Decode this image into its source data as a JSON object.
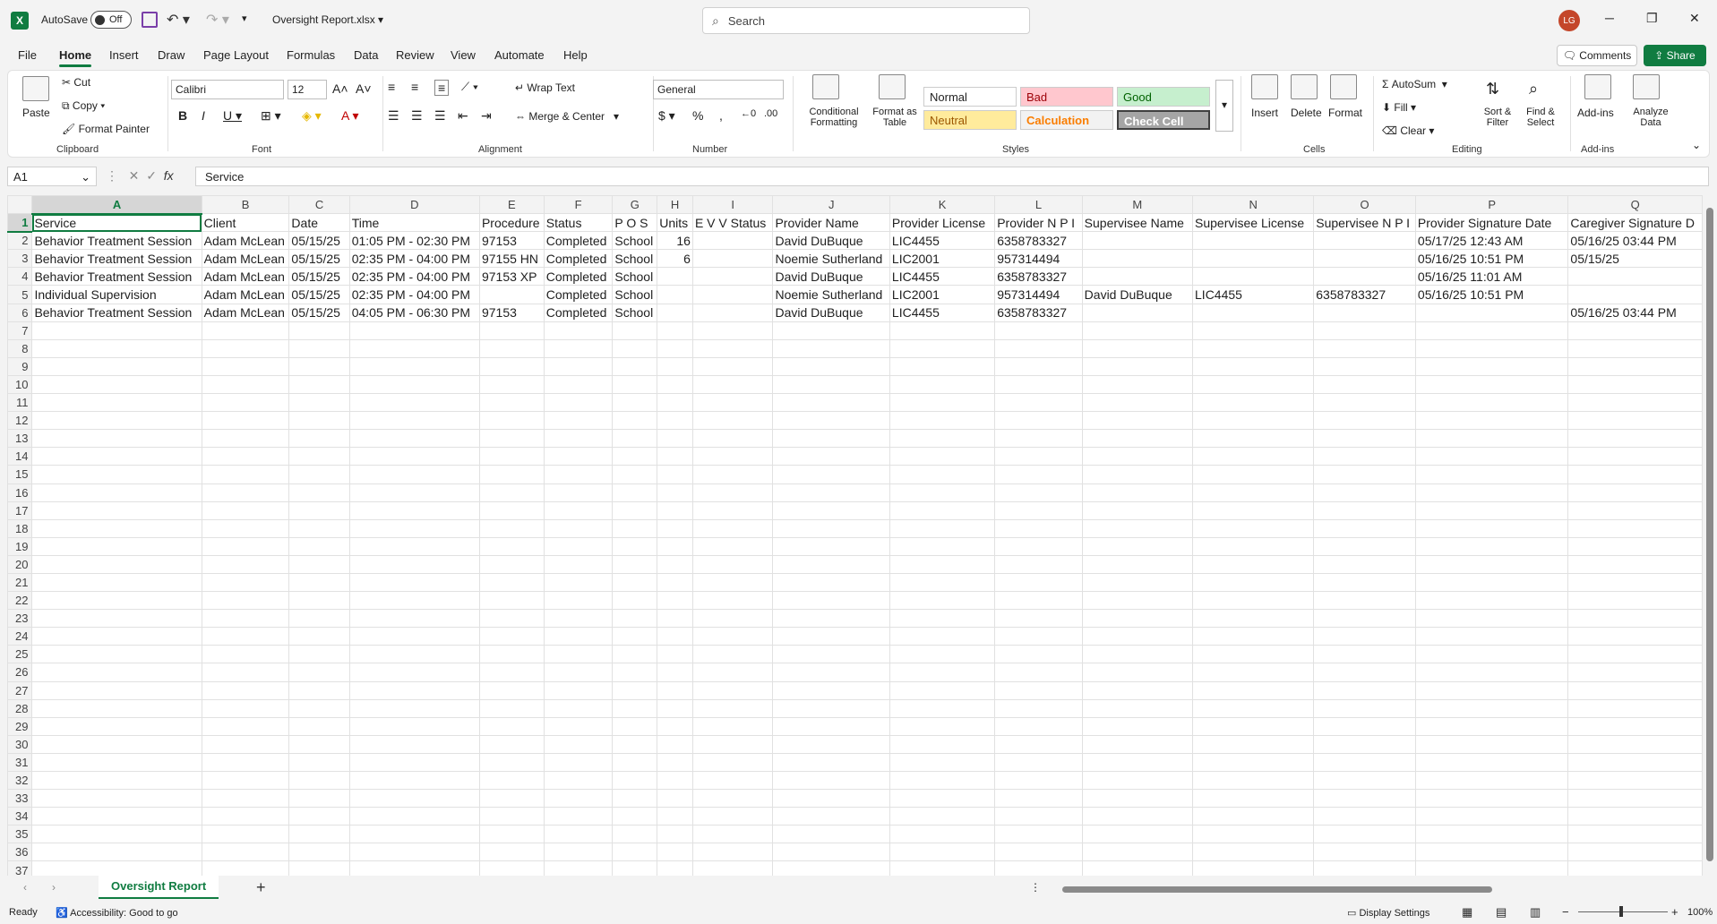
{
  "titlebar": {
    "app_icon": "excel-icon",
    "autosave_label": "AutoSave",
    "autosave_state": "Off",
    "filename": "Oversight Report.xlsx",
    "search_placeholder": "Search",
    "user_initials": "LG"
  },
  "menu": {
    "tabs": [
      "File",
      "Home",
      "Insert",
      "Draw",
      "Page Layout",
      "Formulas",
      "Data",
      "Review",
      "View",
      "Automate",
      "Help"
    ],
    "active": "Home",
    "comments": "Comments",
    "share": "Share"
  },
  "ribbon": {
    "clipboard": {
      "label": "Clipboard",
      "paste": "Paste",
      "cut": "Cut",
      "copy": "Copy",
      "format_painter": "Format Painter"
    },
    "font": {
      "label": "Font",
      "name": "Calibri",
      "size": "12"
    },
    "alignment": {
      "label": "Alignment",
      "wrap": "Wrap Text",
      "merge": "Merge & Center"
    },
    "number": {
      "label": "Number",
      "format": "General"
    },
    "styles": {
      "label": "Styles",
      "conditional": "Conditional Formatting",
      "format_table": "Format as Table",
      "cells": [
        {
          "name": "Normal",
          "bg": "#ffffff",
          "fg": "#000000"
        },
        {
          "name": "Bad",
          "bg": "#ffc7ce",
          "fg": "#9c0006"
        },
        {
          "name": "Good",
          "bg": "#c6efce",
          "fg": "#006100"
        },
        {
          "name": "Neutral",
          "bg": "#ffeb9c",
          "fg": "#9c5700"
        },
        {
          "name": "Calculation",
          "bg": "#f2f2f2",
          "fg": "#fa7d00"
        },
        {
          "name": "Check Cell",
          "bg": "#a5a5a5",
          "fg": "#ffffff"
        }
      ]
    },
    "cells": {
      "label": "Cells",
      "insert": "Insert",
      "delete": "Delete",
      "format": "Format"
    },
    "editing": {
      "label": "Editing",
      "autosum": "AutoSum",
      "fill": "Fill",
      "clear": "Clear",
      "sort": "Sort & Filter",
      "find": "Find & Select"
    },
    "addins": {
      "label": "Add-ins",
      "addins": "Add-ins",
      "analyze": "Analyze Data"
    }
  },
  "formula_bar": {
    "name_box": "A1",
    "fx": "fx",
    "content": "Service"
  },
  "sheet": {
    "columns": [
      "A",
      "B",
      "C",
      "D",
      "E",
      "F",
      "G",
      "H",
      "I",
      "J",
      "K",
      "L",
      "M",
      "N",
      "O",
      "P",
      "Q"
    ],
    "rows": [
      [
        "Service",
        "Client",
        "Date",
        "Time",
        "Procedure",
        "Status",
        "P O S",
        "Units",
        "E V V  Status",
        "Provider  Name",
        "Provider  License",
        "Provider  N P I",
        "Supervisee  Name",
        "Supervisee  License",
        "Supervisee  N P I",
        "Provider  Signature  Date",
        "Caregiver  Signature  D"
      ],
      [
        "Behavior Treatment Session",
        "Adam McLean",
        "05/15/25",
        "01:05 PM - 02:30 PM",
        "97153",
        "Completed",
        "School",
        "16",
        "",
        "David DuBuque",
        "LIC4455",
        "6358783327",
        "",
        "",
        "",
        "05/17/25 12:43 AM",
        "05/16/25 03:44 PM"
      ],
      [
        "Behavior Treatment Session",
        "Adam McLean",
        "05/15/25",
        "02:35 PM - 04:00 PM",
        "97155 HN",
        "Completed",
        "School",
        "6",
        "",
        "Noemie Sutherland",
        "LIC2001",
        "957314494",
        "",
        "",
        "",
        "05/16/25 10:51 PM",
        "05/15/25"
      ],
      [
        "Behavior Treatment Session",
        "Adam McLean",
        "05/15/25",
        "02:35 PM - 04:00 PM",
        "97153 XP",
        "Completed",
        "School",
        "",
        "",
        "David DuBuque",
        "LIC4455",
        "6358783327",
        "",
        "",
        "",
        "05/16/25 11:01 AM",
        ""
      ],
      [
        "Individual Supervision",
        "Adam McLean",
        "05/15/25",
        "02:35 PM - 04:00 PM",
        "",
        "Completed",
        "School",
        "",
        "",
        "Noemie Sutherland",
        "LIC2001",
        "957314494",
        "David DuBuque",
        "LIC4455",
        "6358783327",
        "05/16/25 10:51 PM",
        ""
      ],
      [
        "Behavior Treatment Session",
        "Adam McLean",
        "05/15/25",
        "04:05 PM - 06:30 PM",
        "97153",
        "Completed",
        "School",
        "",
        "",
        "David DuBuque",
        "LIC4455",
        "6358783327",
        "",
        "",
        "",
        "",
        "05/16/25 03:44 PM"
      ]
    ],
    "row_count": 37,
    "tab": "Oversight Report"
  },
  "status": {
    "ready": "Ready",
    "accessibility": "Accessibility: Good to go",
    "display": "Display Settings",
    "zoom": "100%"
  }
}
